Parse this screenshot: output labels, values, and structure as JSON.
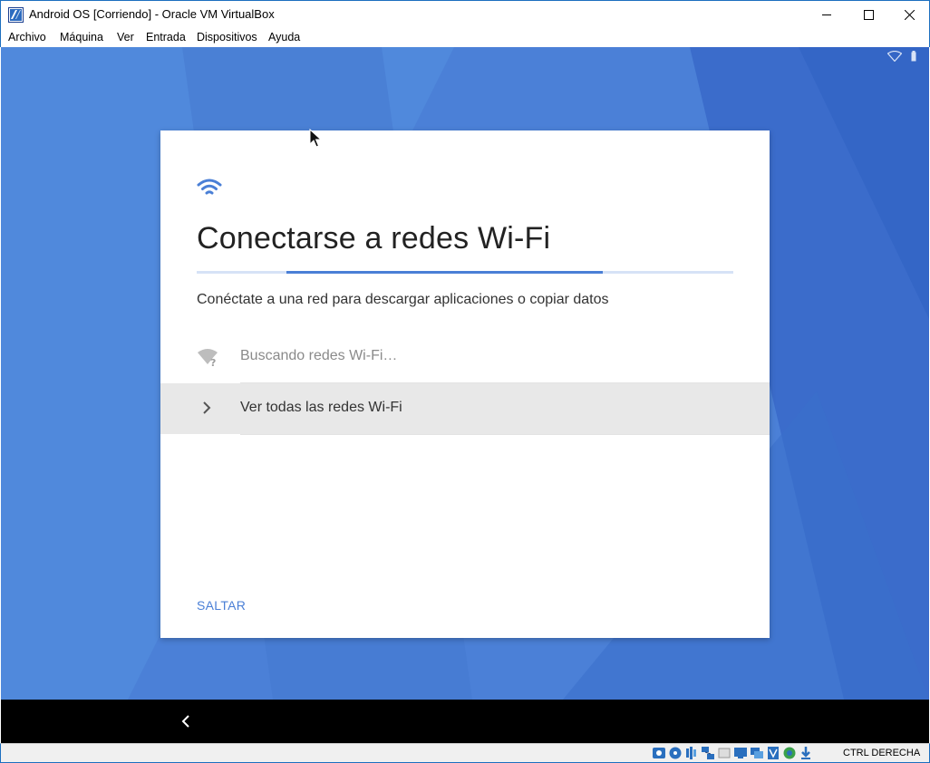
{
  "window": {
    "title": "Android OS [Corriendo] - Oracle VM VirtualBox",
    "icons": [
      "virtualbox-app-icon",
      "minimize-icon",
      "maximize-icon",
      "close-icon"
    ]
  },
  "menu": {
    "items": [
      "Archivo",
      "Máquina",
      "Ver",
      "Entrada",
      "Dispositivos",
      "Ayuda"
    ]
  },
  "android": {
    "status_icons": [
      "wifi-icon",
      "battery-icon"
    ],
    "setup": {
      "title": "Conectarse a redes Wi-Fi",
      "subtitle": "Conéctate a una red para descargar aplicaciones o copiar datos",
      "searching_label": "Buscando redes Wi-Fi…",
      "see_all_label": "Ver todas las redes Wi-Fi",
      "skip_label": "SALTAR"
    },
    "navbar": {
      "back_icon": "back-icon"
    }
  },
  "statusbar": {
    "host_key": "CTRL DERECHA",
    "device_icons": [
      "hard-disk-icon",
      "optical-drive-icon",
      "audio-icon",
      "network-icon",
      "usb-icon",
      "shared-folders-icon",
      "display-icon",
      "video-capture-icon",
      "vt-x-icon",
      "mouse-integration-icon",
      "keyboard-icon"
    ]
  },
  "colors": {
    "android_blue": "#4a7fd6",
    "window_border": "#1c6fbf"
  }
}
